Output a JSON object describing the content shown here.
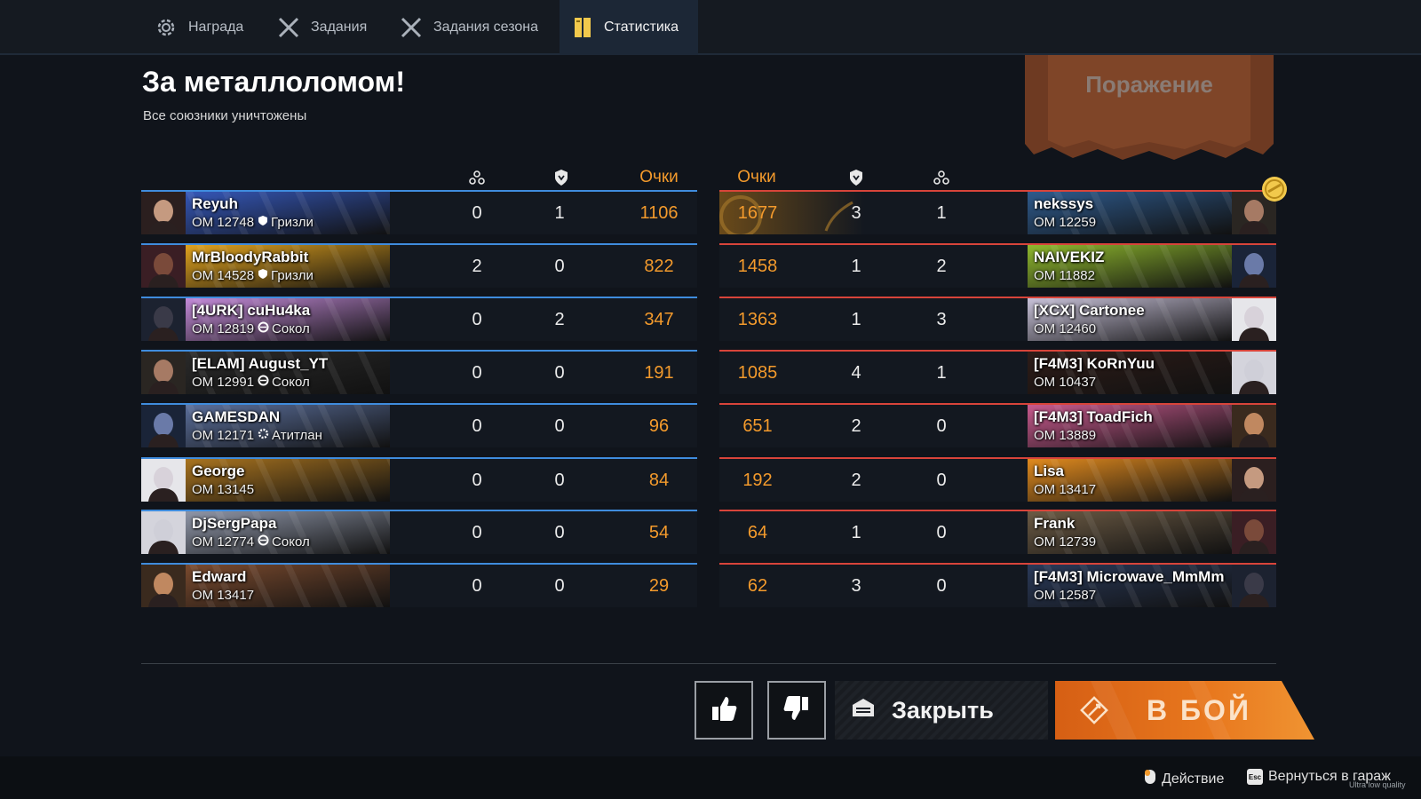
{
  "tabs": [
    {
      "label": "Награда",
      "icon": "reward-gear-icon"
    },
    {
      "label": "Задания",
      "icon": "crossed-swords-icon"
    },
    {
      "label": "Задания сезона",
      "icon": "crossed-swords-icon"
    },
    {
      "label": "Статистика",
      "icon": "statistics-book-icon",
      "active": true
    }
  ],
  "mission": {
    "title": "За металлоломом!",
    "subtitle": "Все союзники уничтожены",
    "result": "Поражение"
  },
  "columns": {
    "ally_score": "Очки",
    "enemy_score": "Очки",
    "kills_icon": "kills-icon",
    "assists_icon": "shield-assist-icon"
  },
  "allies": [
    {
      "name": "Reyuh",
      "om": "ОМ 12748",
      "clan": "Гризли",
      "clan_icon": "shield-clan-icon",
      "kills": "0",
      "assists": "1",
      "score": "1106",
      "card": "#3557b8"
    },
    {
      "name": "MrBloodyRabbit",
      "om": "ОМ 14528",
      "clan": "Гризли",
      "clan_icon": "shield-clan-icon",
      "kills": "2",
      "assists": "0",
      "score": "822",
      "card": "#e0a21e"
    },
    {
      "name": "[4URK] cuHu4ka",
      "om": "ОМ 12819",
      "clan": "Сокол",
      "clan_icon": "circle-clan-icon",
      "kills": "0",
      "assists": "2",
      "score": "347",
      "card": "#c38ad8"
    },
    {
      "name": "[ELAM] August_YT",
      "om": "ОМ 12991",
      "clan": "Сокол",
      "clan_icon": "circle-clan-icon",
      "kills": "0",
      "assists": "0",
      "score": "191",
      "card": "#2a2a2a"
    },
    {
      "name": "GAMESDAN",
      "om": "ОМ 12171",
      "clan": "Атитлан",
      "clan_icon": "gear-clan-icon",
      "kills": "0",
      "assists": "0",
      "score": "96",
      "card": "#5b6f9b"
    },
    {
      "name": "George",
      "om": "ОМ 13145",
      "clan": "",
      "clan_icon": "",
      "kills": "0",
      "assists": "0",
      "score": "84",
      "card": "#a8731f"
    },
    {
      "name": "DjSergPapa",
      "om": "ОМ 12774",
      "clan": "Сокол",
      "clan_icon": "circle-clan-icon",
      "kills": "0",
      "assists": "0",
      "score": "54",
      "card": "#8f96a8"
    },
    {
      "name": "Edward",
      "om": "ОМ 13417",
      "clan": "",
      "clan_icon": "",
      "kills": "0",
      "assists": "0",
      "score": "29",
      "card": "#7a4a2e"
    }
  ],
  "enemies": [
    {
      "name": "nekssys",
      "om": "ОМ 12259",
      "score": "1677",
      "assists": "3",
      "kills": "1",
      "card": "#2e5a8c",
      "top": true
    },
    {
      "name": "NAIVEKIZ",
      "om": "ОМ 11882",
      "score": "1458",
      "assists": "1",
      "kills": "2",
      "card": "#8fb82e"
    },
    {
      "name": "[XCX] Cartonee",
      "om": "ОМ 12460",
      "score": "1363",
      "assists": "1",
      "kills": "3",
      "card": "#c7c1d8"
    },
    {
      "name": "[F4M3] KoRnYuu",
      "om": "ОМ 10437",
      "score": "1085",
      "assists": "4",
      "kills": "1",
      "card": "#2e1c18"
    },
    {
      "name": "[F4M3] ToadFich",
      "om": "ОМ 13889",
      "score": "651",
      "assists": "2",
      "kills": "0",
      "card": "#c85a8e"
    },
    {
      "name": "Lisa",
      "om": "ОМ 13417",
      "score": "192",
      "assists": "2",
      "kills": "0",
      "card": "#e08a1e"
    },
    {
      "name": "Frank",
      "om": "ОМ 12739",
      "score": "64",
      "assists": "1",
      "kills": "0",
      "card": "#6b5a44"
    },
    {
      "name": "[F4M3] Microwave_MmMm",
      "om": "ОМ 12587",
      "score": "62",
      "assists": "3",
      "kills": "0",
      "card": "#2a3a5a"
    }
  ],
  "buttons": {
    "close": "Закрыть",
    "battle": "В БОЙ",
    "like_icon": "thumbs-up-icon",
    "dislike_icon": "thumbs-down-icon"
  },
  "footer": {
    "action": "Действие",
    "action_icon": "mouse-icon",
    "garage": "Вернуться в гараж",
    "garage_key": "Esc",
    "quality": "Ultra low quality"
  },
  "colors": {
    "accent": "#f39a2c",
    "ally_line": "#3f8cdd",
    "enemy_line": "#d8443a",
    "battle_button": "#e0701e",
    "result_banner": "#6e3a22"
  }
}
